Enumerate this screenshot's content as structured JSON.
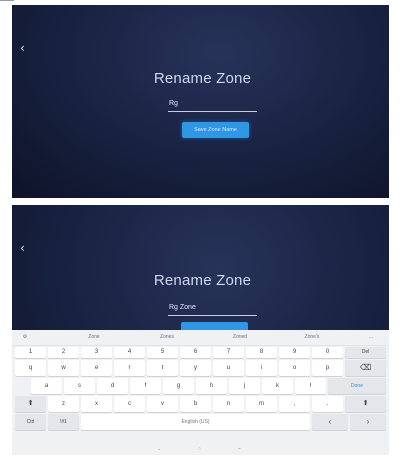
{
  "screens": [
    {
      "back_icon": "‹",
      "title": "Rename Zone",
      "input_value": "Rg",
      "save_label": "Save Zone Name"
    },
    {
      "back_icon": "‹",
      "title": "Rename Zone",
      "input_value": "Rg Zone"
    }
  ],
  "keyboard": {
    "settings_icon": "⚙",
    "suggestions": [
      "Zone",
      "Zones",
      "Zoned",
      "Zone's"
    ],
    "more_icon": "…",
    "number_row": [
      "1",
      "2",
      "3",
      "4",
      "5",
      "6",
      "7",
      "8",
      "9",
      "0"
    ],
    "delete_label": "Del",
    "row1": [
      "q",
      "w",
      "e",
      "r",
      "t",
      "y",
      "u",
      "i",
      "o",
      "p"
    ],
    "backspace_icon": "⌫",
    "row2": [
      "a",
      "s",
      "d",
      "f",
      "g",
      "h",
      "j",
      "k",
      "l"
    ],
    "done_label": "Done",
    "shift_icon": "⬆",
    "row3": [
      "z",
      "x",
      "c",
      "v",
      "b",
      "n",
      "m",
      ",",
      "."
    ],
    "ctrl_label": "Ctrl",
    "symbols_label": "!#1",
    "space_label": "English (US)",
    "left_arrow": "‹",
    "right_arrow": "›",
    "nav_back": "⌄",
    "nav_home": "○",
    "nav_recent": "⌁"
  }
}
